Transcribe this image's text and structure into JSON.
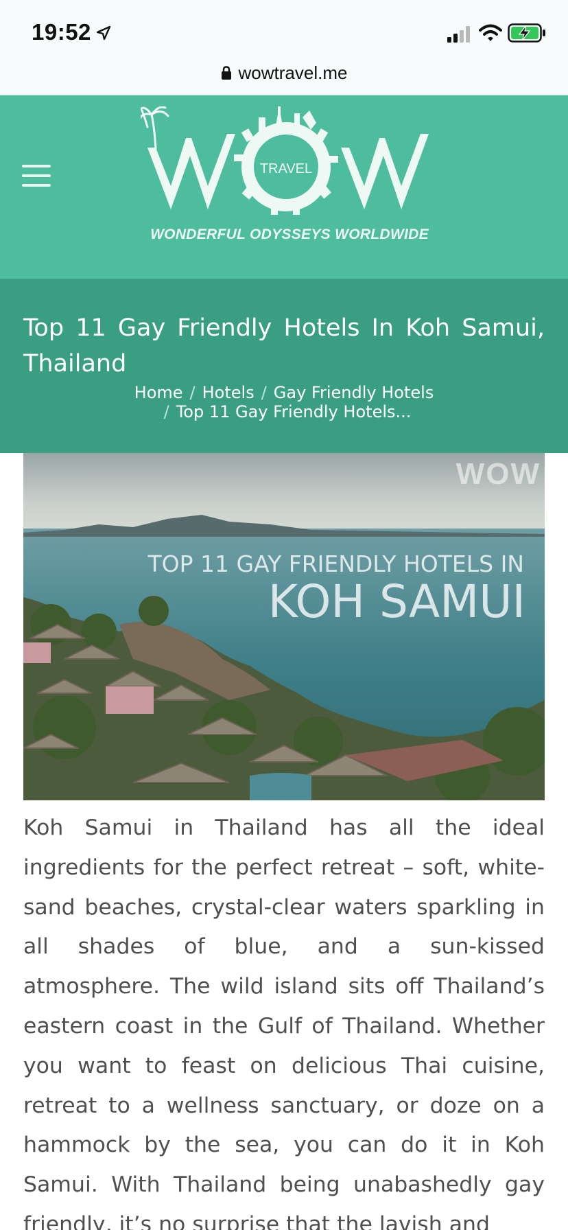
{
  "status_bar": {
    "time": "19:52",
    "icons": [
      "location-arrow-icon",
      "cellular-signal-icon",
      "wifi-icon",
      "battery-charging-icon"
    ],
    "battery_color": "#33c759"
  },
  "browser": {
    "url": "wowtravel.me",
    "secure_icon": "lock-icon"
  },
  "header": {
    "menu_icon": "hamburger-menu-icon",
    "logo_text": "WOW",
    "logo_badge": "TRAVEL",
    "tagline": "WONDERFUL  ODYSSEYS  WORLDWIDE",
    "background": "#4dbd9e"
  },
  "title_band": {
    "title": "Top 11 Gay Friendly Hotels In Koh Samui, Thailand",
    "background": "#3a9f82",
    "breadcrumb": {
      "home": "Home",
      "hotels": "Hotels",
      "category": "Gay Friendly Hotels",
      "current": "Top 11 Gay Friendly Hotels...",
      "separator": "/"
    }
  },
  "hero_image": {
    "watermark": "WOW",
    "line1": "TOP 11 GAY FRIENDLY HOTELS IN",
    "line2": "KOH SAMUI"
  },
  "article": {
    "intro": "Koh Samui in Thailand has all the ideal ingredients for the perfect retreat – soft, white-sand beaches, crystal-clear waters sparkling in all shades of blue, and a sun-kissed atmosphere. The wild island sits off Thailand’s eastern coast in the Gulf of Thailand. Whether you want to feast on delicious Thai cuisine, retreat to a wellness sanctuary, or doze on a hammock by the sea, you can do it in Koh Samui. With Thailand being unabashedly gay friendly, it’s no surprise that the lavish and"
  }
}
